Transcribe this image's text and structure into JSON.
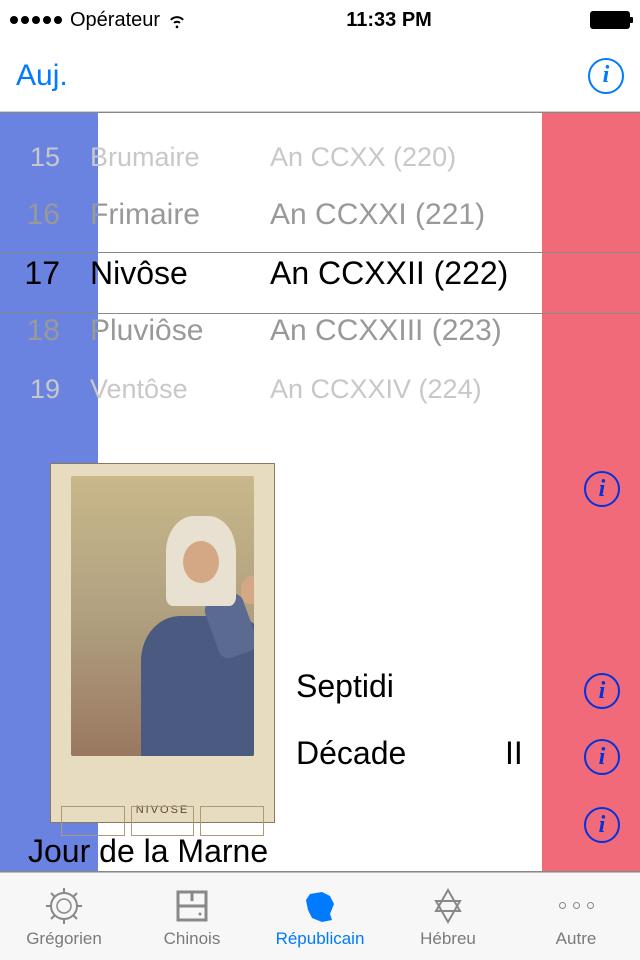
{
  "status": {
    "carrier": "Opérateur",
    "time": "11:33 PM"
  },
  "nav": {
    "today": "Auj."
  },
  "picker": {
    "rows": [
      {
        "day": "15",
        "month": "Brumaire",
        "year": "An CCXX (220)"
      },
      {
        "day": "16",
        "month": "Frimaire",
        "year": "An CCXXI (221)"
      },
      {
        "day": "17",
        "month": "Nivôse",
        "year": "An CCXXII (222)"
      },
      {
        "day": "18",
        "month": "Pluviôse",
        "year": "An CCXXIII (223)"
      },
      {
        "day": "19",
        "month": "Ventôse",
        "year": "An CCXXIV (224)"
      }
    ]
  },
  "illustration": {
    "caption": "NIVOSE"
  },
  "details": {
    "day_name": "Septidi",
    "decade_label": "Décade",
    "decade_value": "II",
    "jour": "Jour de la Marne"
  },
  "tabs": [
    {
      "label": "Grégorien"
    },
    {
      "label": "Chinois"
    },
    {
      "label": "Républicain"
    },
    {
      "label": "Hébreu"
    },
    {
      "label": "Autre"
    }
  ],
  "colors": {
    "ios_blue": "#007aff",
    "flag_blue": "#6a83e0",
    "flag_red": "#f06a7a",
    "info_blue": "#0033dd"
  }
}
